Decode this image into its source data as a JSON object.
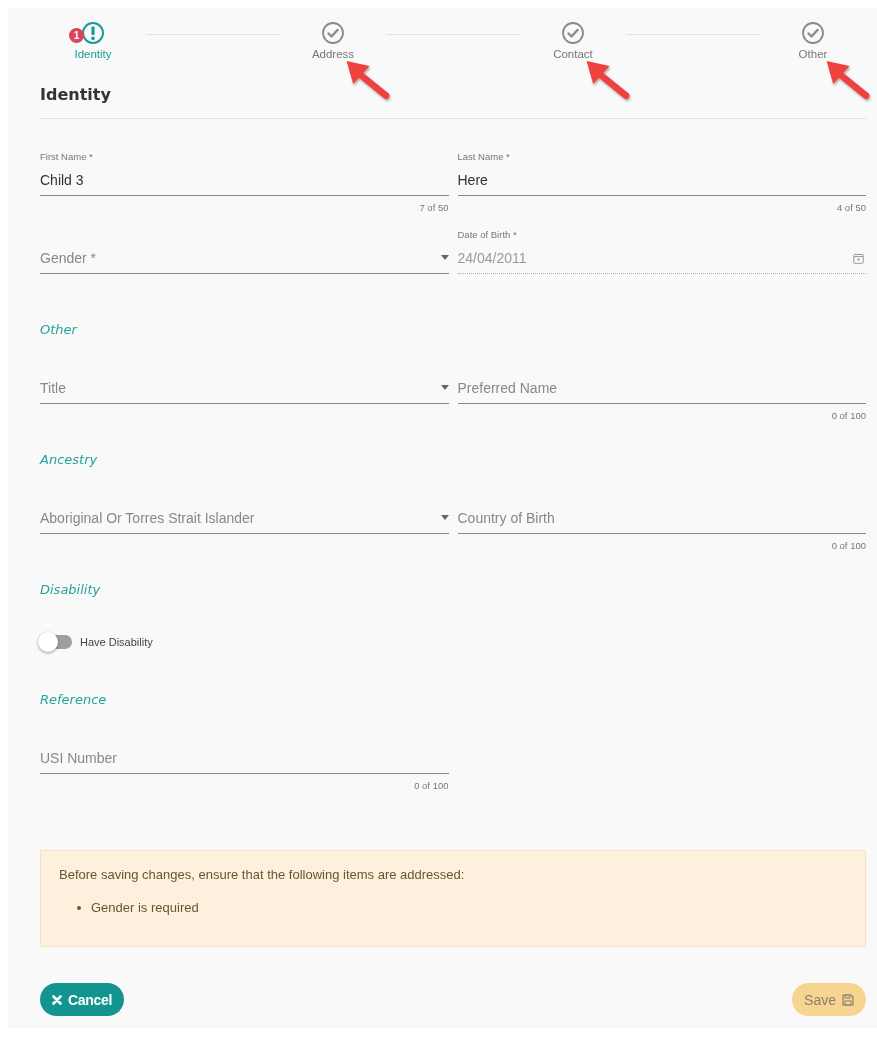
{
  "steps": [
    {
      "label": "Identity",
      "selected": true,
      "kind": "error",
      "badge": "1",
      "pointed": false
    },
    {
      "label": "Address",
      "selected": false,
      "kind": "done",
      "pointed": true
    },
    {
      "label": "Contact",
      "selected": false,
      "kind": "done",
      "pointed": true
    },
    {
      "label": "Other",
      "selected": false,
      "kind": "done",
      "pointed": true
    }
  ],
  "title": "Identity",
  "sections": [
    {
      "rows": [
        [
          {
            "kind": "text",
            "label": "First Name *",
            "value": "Child 3",
            "counter": "7 of 50"
          },
          {
            "kind": "text",
            "label": "Last Name *",
            "value": "Here",
            "counter": "4 of 50"
          }
        ],
        [
          {
            "kind": "select",
            "placeholder": "Gender *"
          },
          {
            "kind": "date",
            "label": "Date of Birth *",
            "value": "24/04/2011",
            "disabled": true
          }
        ]
      ]
    },
    {
      "heading": "Other",
      "rows": [
        [
          {
            "kind": "select",
            "placeholder": "Title"
          },
          {
            "kind": "text",
            "placeholder": "Preferred Name",
            "counter": "0 of 100"
          }
        ]
      ]
    },
    {
      "heading": "Ancestry",
      "rows": [
        [
          {
            "kind": "select",
            "placeholder": "Aboriginal Or Torres Strait Islander"
          },
          {
            "kind": "text",
            "placeholder": "Country of Birth",
            "counter": "0 of 100"
          }
        ]
      ]
    },
    {
      "heading": "Disability",
      "toggle": {
        "label": "Have Disability",
        "on": false
      }
    },
    {
      "heading": "Reference",
      "rows": [
        [
          {
            "kind": "text",
            "placeholder": "USI Number",
            "counter": "0 of 100"
          }
        ]
      ]
    }
  ],
  "notice": {
    "message": "Before saving changes, ensure that the following items are addressed:",
    "items": [
      "Gender is required"
    ]
  },
  "buttons": [
    {
      "kind": "cancel",
      "label": "Cancel"
    },
    {
      "kind": "save",
      "label": "Save",
      "disabled": true
    }
  ]
}
